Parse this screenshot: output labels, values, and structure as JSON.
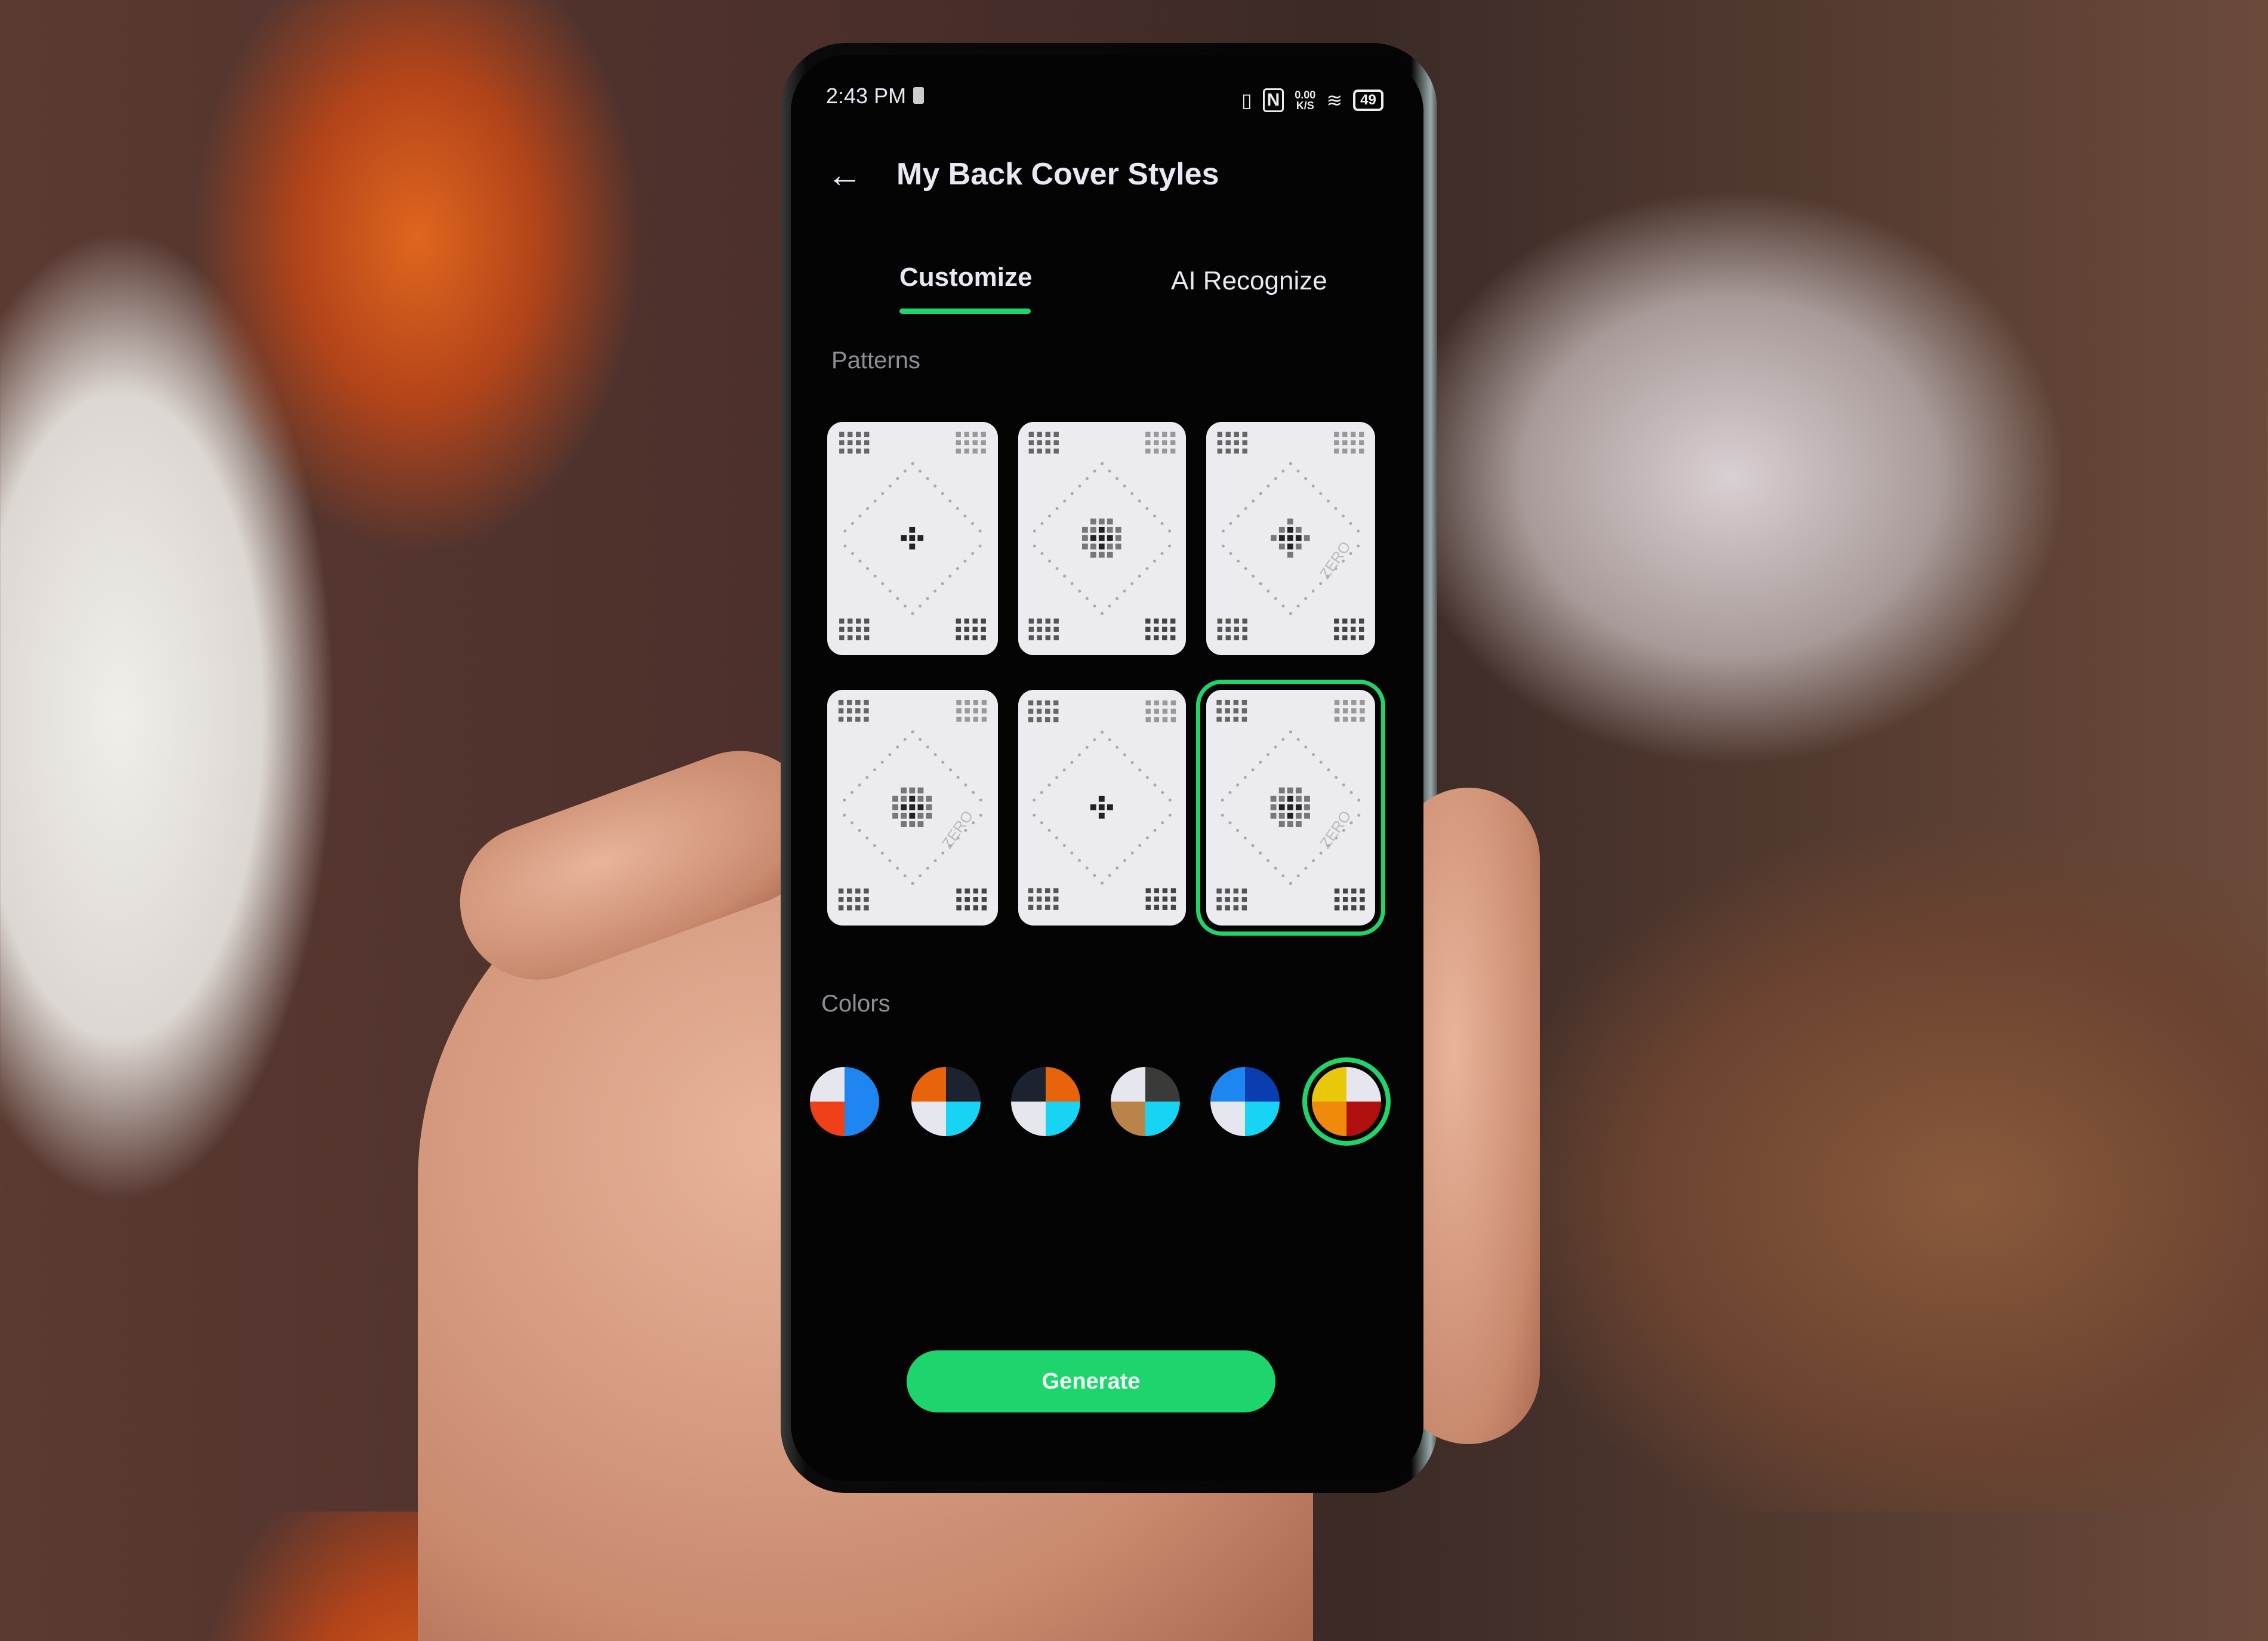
{
  "status_bar": {
    "time": "2:43 PM",
    "net_speed": "0.00",
    "net_unit": "K/S",
    "battery": "49"
  },
  "header": {
    "title": "My Back Cover Styles",
    "back_icon": "arrow-left-icon"
  },
  "tabs": [
    {
      "label": "Customize",
      "active": true
    },
    {
      "label": "AI Recognize",
      "active": false
    }
  ],
  "patterns": {
    "label": "Patterns",
    "selected_index": 5,
    "count": 6,
    "watermark": "ZERO"
  },
  "colors": {
    "label": "Colors",
    "selected_index": 5,
    "swatches": [
      [
        "#e6e6ee",
        "#1e86f0",
        "#f0401a",
        "#1e86f0"
      ],
      [
        "#e8640c",
        "#1c2230",
        "#e6e6ee",
        "#18d4f4"
      ],
      [
        "#1c2230",
        "#e8640c",
        "#e6e6ee",
        "#18d4f4"
      ],
      [
        "#e6e6ee",
        "#3a3a38",
        "#b88448",
        "#18d4f4"
      ],
      [
        "#1e86f0",
        "#0a3eb0",
        "#e6e6ee",
        "#18d4f4"
      ],
      [
        "#e8c80a",
        "#e6e6ee",
        "#f08a0a",
        "#b01010"
      ]
    ]
  },
  "generate_label": "Generate",
  "accent": "#1ed46c"
}
